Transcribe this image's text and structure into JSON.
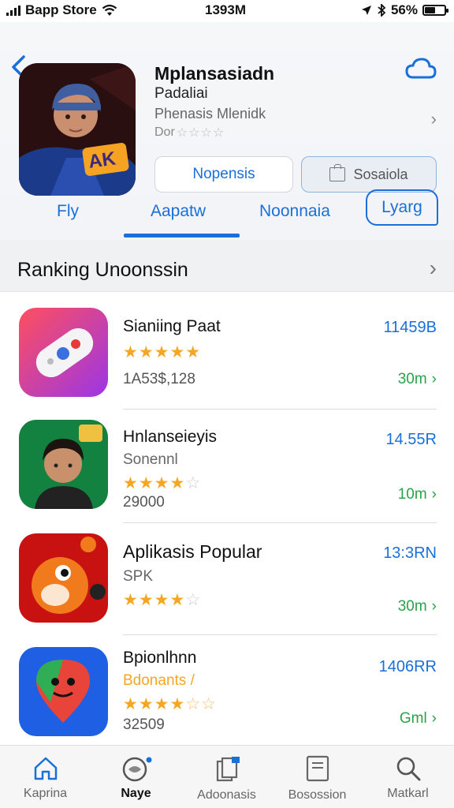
{
  "status_bar": {
    "carrier": "Bapp Store",
    "time": "1393M",
    "battery": "56%",
    "battery_level": 0.56
  },
  "app": {
    "title": "Mplansasiadn",
    "subtitle": "Padaliai",
    "developer": "Phenasis Mlenidk",
    "rating_prefix": "Dor",
    "rating_stars": "☆☆☆☆",
    "icon_badge": "AK",
    "primary_button": "Nopensis",
    "secondary_button": "Sosaiola"
  },
  "tabs": {
    "items": [
      "Fly",
      "Aapatw",
      "Noonnaia",
      "Lyarg"
    ],
    "active_index": 1
  },
  "section": {
    "title": "Ranking Unoonssin"
  },
  "list": [
    {
      "name": "Sianiing Paat",
      "sub": "",
      "stars_filled": "★★★★★",
      "stars_empty": "",
      "count": "1A53$,128",
      "size": "11459B",
      "time": "30m",
      "icon_colors": [
        "#f2435c",
        "#b63be0"
      ]
    },
    {
      "name": "Hnlanseieyis",
      "sub": "Sonennl",
      "stars_filled": "★★★★",
      "stars_empty": "☆",
      "count": "29000",
      "size": "14.55R",
      "time": "10m",
      "icon_colors": [
        "#0e7a3a",
        "#2f9e4e"
      ]
    },
    {
      "name": "Aplikasis Popular",
      "sub": "SPK",
      "stars_filled": "★★★★",
      "stars_empty": "☆",
      "count": "",
      "size": "13:3RN",
      "time": "30m",
      "icon_colors": [
        "#c41414",
        "#e0341a"
      ]
    },
    {
      "name": "Bpionlhnn",
      "sub": "Bdonants /",
      "stars_filled": "★★★★",
      "stars_empty": "☆☆",
      "count": "32509",
      "size": "1406RR",
      "time": "Gml",
      "icon_colors": [
        "#1a5be0",
        "#2d7bff"
      ]
    }
  ],
  "tabbar": {
    "items": [
      "Kaprina",
      "Naye",
      "Adoonasis",
      "Bosossion",
      "Matkarl"
    ],
    "active_index": 1
  },
  "colors": {
    "accent": "#1a6fd8",
    "stars": "#f5a623",
    "time_green": "#2aa24a"
  }
}
